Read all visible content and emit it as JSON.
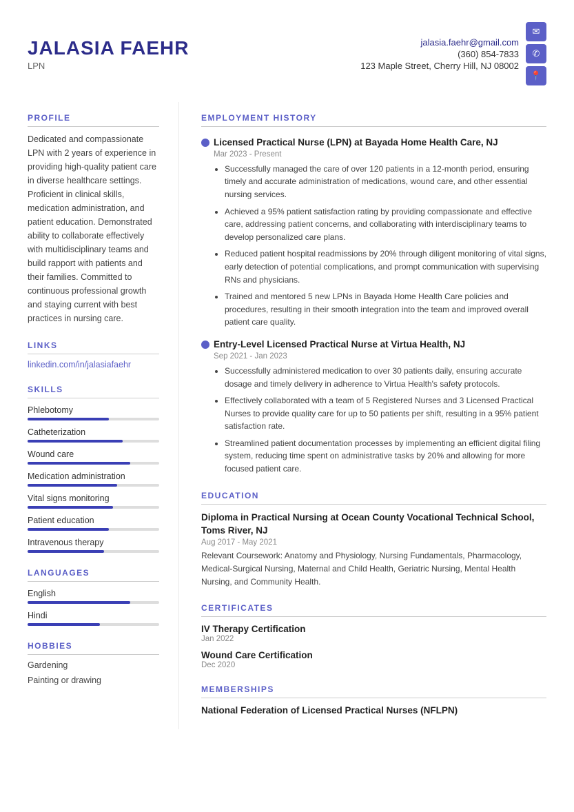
{
  "header": {
    "name": "JALASIA FAEHR",
    "title": "LPN",
    "email": "jalasia.faehr@gmail.com",
    "phone": "(360) 854-7833",
    "address": "123 Maple Street, Cherry Hill, NJ 08002",
    "icons": {
      "email": "✉",
      "phone": "✆",
      "location": "⚲"
    }
  },
  "profile": {
    "section_title": "PROFILE",
    "text": "Dedicated and compassionate LPN with 2 years of experience in providing high-quality patient care in diverse healthcare settings. Proficient in clinical skills, medication administration, and patient education. Demonstrated ability to collaborate effectively with multidisciplinary teams and build rapport with patients and their families. Committed to continuous professional growth and staying current with best practices in nursing care."
  },
  "links": {
    "section_title": "LINKS",
    "items": [
      {
        "label": "linkedin.com/in/jalasiafaehr",
        "url": "#"
      }
    ]
  },
  "skills": {
    "section_title": "SKILLS",
    "items": [
      {
        "name": "Phlebotomy",
        "percent": 62
      },
      {
        "name": "Catheterization",
        "percent": 72
      },
      {
        "name": "Wound care",
        "percent": 78
      },
      {
        "name": "Medication administration",
        "percent": 68
      },
      {
        "name": "Vital signs monitoring",
        "percent": 65
      },
      {
        "name": "Patient education",
        "percent": 62
      },
      {
        "name": "Intravenous therapy",
        "percent": 58
      }
    ]
  },
  "languages": {
    "section_title": "LANGUAGES",
    "items": [
      {
        "name": "English",
        "percent": 78
      },
      {
        "name": "Hindi",
        "percent": 55
      }
    ]
  },
  "hobbies": {
    "section_title": "HOBBIES",
    "items": [
      "Gardening",
      "Painting or drawing"
    ]
  },
  "employment": {
    "section_title": "EMPLOYMENT HISTORY",
    "jobs": [
      {
        "title": "Licensed Practical Nurse (LPN) at Bayada Home Health Care, NJ",
        "date": "Mar 2023 - Present",
        "bullets": [
          "Successfully managed the care of over 120 patients in a 12-month period, ensuring timely and accurate administration of medications, wound care, and other essential nursing services.",
          "Achieved a 95% patient satisfaction rating by providing compassionate and effective care, addressing patient concerns, and collaborating with interdisciplinary teams to develop personalized care plans.",
          "Reduced patient hospital readmissions by 20% through diligent monitoring of vital signs, early detection of potential complications, and prompt communication with supervising RNs and physicians.",
          "Trained and mentored 5 new LPNs in Bayada Home Health Care policies and procedures, resulting in their smooth integration into the team and improved overall patient care quality."
        ]
      },
      {
        "title": "Entry-Level Licensed Practical Nurse at Virtua Health, NJ",
        "date": "Sep 2021 - Jan 2023",
        "bullets": [
          "Successfully administered medication to over 30 patients daily, ensuring accurate dosage and timely delivery in adherence to Virtua Health's safety protocols.",
          "Effectively collaborated with a team of 5 Registered Nurses and 3 Licensed Practical Nurses to provide quality care for up to 50 patients per shift, resulting in a 95% patient satisfaction rate.",
          "Streamlined patient documentation processes by implementing an efficient digital filing system, reducing time spent on administrative tasks by 20% and allowing for more focused patient care."
        ]
      }
    ]
  },
  "education": {
    "section_title": "EDUCATION",
    "entries": [
      {
        "title": "Diploma in Practical Nursing at Ocean County Vocational Technical School, Toms River, NJ",
        "date": "Aug 2017 - May 2021",
        "text": "Relevant Coursework: Anatomy and Physiology, Nursing Fundamentals, Pharmacology, Medical-Surgical Nursing, Maternal and Child Health, Geriatric Nursing, Mental Health Nursing, and Community Health."
      }
    ]
  },
  "certificates": {
    "section_title": "CERTIFICATES",
    "entries": [
      {
        "title": "IV Therapy Certification",
        "date": "Jan 2022"
      },
      {
        "title": "Wound Care Certification",
        "date": "Dec 2020"
      }
    ]
  },
  "memberships": {
    "section_title": "MEMBERSHIPS",
    "entries": [
      {
        "title": "National Federation of Licensed Practical Nurses (NFLPN)"
      }
    ]
  }
}
